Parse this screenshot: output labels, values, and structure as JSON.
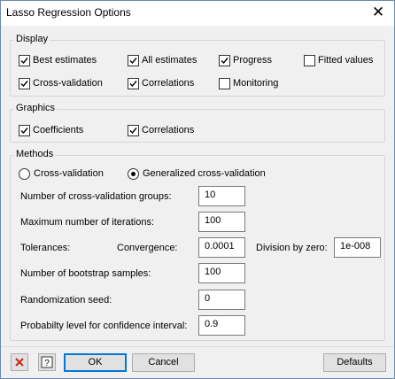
{
  "window": {
    "title": "Lasso Regression Options"
  },
  "display": {
    "label": "Display",
    "options": [
      {
        "label": "Best estimates",
        "checked": true
      },
      {
        "label": "All estimates",
        "checked": true
      },
      {
        "label": "Progress",
        "checked": true
      },
      {
        "label": "Fitted values",
        "checked": false
      },
      {
        "label": "Cross-validation",
        "checked": true
      },
      {
        "label": "Correlations",
        "checked": true
      },
      {
        "label": "Monitoring",
        "checked": false
      }
    ]
  },
  "graphics": {
    "label": "Graphics",
    "options": [
      {
        "label": "Coefficients",
        "checked": true
      },
      {
        "label": "Correlations",
        "checked": true
      }
    ]
  },
  "methods": {
    "label": "Methods",
    "radio": [
      {
        "label": "Cross-validation",
        "selected": false
      },
      {
        "label": "Generalized cross-validation",
        "selected": true
      }
    ],
    "cv_groups_label": "Number of cross-validation groups:",
    "cv_groups_value": "10",
    "max_iter_label": "Maximum number of iterations:",
    "max_iter_value": "100",
    "tolerances_label": "Tolerances:",
    "convergence_label": "Convergence:",
    "convergence_value": "0.0001",
    "division_label": "Division by zero:",
    "division_value": "1e-008",
    "bootstrap_label": "Number of bootstrap samples:",
    "bootstrap_value": "100",
    "seed_label": "Randomization seed:",
    "seed_value": "0",
    "prob_label": "Probabilty level for confidence interval:",
    "prob_value": "0.9"
  },
  "footer": {
    "ok_label": "OK",
    "cancel_label": "Cancel",
    "defaults_label": "Defaults",
    "clear_icon": "red-x-icon",
    "help_icon": "help-question-icon"
  },
  "colors": {
    "accent": "#0078d7",
    "clear_red": "#c42b1c"
  }
}
